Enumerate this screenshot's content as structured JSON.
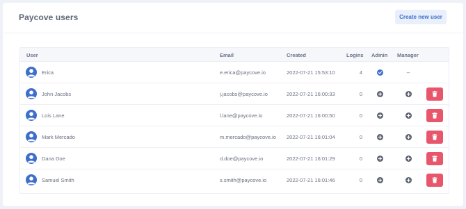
{
  "header": {
    "title": "Paycove users",
    "create_button": "Create new user"
  },
  "table": {
    "columns": {
      "user": "User",
      "email": "Email",
      "created": "Created",
      "logins": "Logins",
      "admin": "Admin",
      "manager": "Manager"
    },
    "rows": [
      {
        "name": "Erica",
        "email": "e.erica@paycove.io",
        "created": "2022-07-21 15:53:10",
        "logins": "4",
        "admin": "check-circle-icon",
        "manager": "–",
        "deletable": false
      },
      {
        "name": "John Jacobs",
        "email": "j.jacobs@paycove.io",
        "created": "2022-07-21 16:00:33",
        "logins": "0",
        "admin": "plus-circle-icon",
        "manager": "plus-circle-icon",
        "deletable": true
      },
      {
        "name": "Lois Lane",
        "email": "l.lane@paycove.io",
        "created": "2022-07-21 16:00:50",
        "logins": "0",
        "admin": "plus-circle-icon",
        "manager": "plus-circle-icon",
        "deletable": true
      },
      {
        "name": "Mark Mercado",
        "email": "m.mercado@paycove.io",
        "created": "2022-07-21 16:01:04",
        "logins": "0",
        "admin": "plus-circle-icon",
        "manager": "plus-circle-icon",
        "deletable": true
      },
      {
        "name": "Dana Doe",
        "email": "d.doe@paycove.io",
        "created": "2022-07-21 16:01:29",
        "logins": "0",
        "admin": "plus-circle-icon",
        "manager": "plus-circle-icon",
        "deletable": true
      },
      {
        "name": "Samuel Smith",
        "email": "s.smith@paycove.io",
        "created": "2022-07-21 16:01:46",
        "logins": "0",
        "admin": "plus-circle-icon",
        "manager": "plus-circle-icon",
        "deletable": true
      }
    ]
  },
  "colors": {
    "accent": "#3f6fcb",
    "danger": "#e8566c",
    "button_bg": "#e9f0fb"
  }
}
